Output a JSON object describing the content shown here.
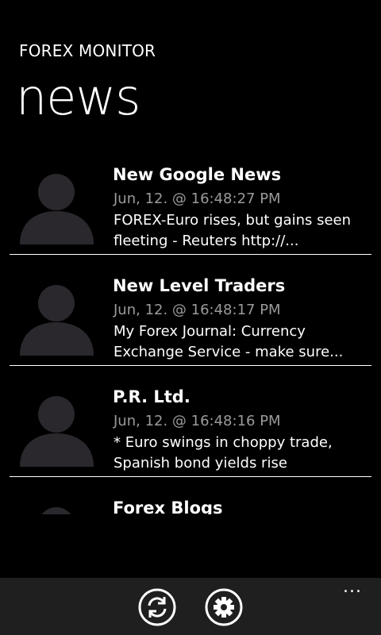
{
  "app": {
    "title": "FOREX MONITOR",
    "page_title": "news"
  },
  "news": [
    {
      "source": "New Google News",
      "time": "Jun, 12. @ 16:48:27 PM",
      "summary_line1": "FOREX-Euro rises, but gains seen",
      "summary_line2": "fleeting - Reuters http://..."
    },
    {
      "source": "New Level Traders",
      "time": "Jun, 12. @ 16:48:17 PM",
      "summary_line1": "My Forex Journal: Currency",
      "summary_line2": "Exchange Service - make sure..."
    },
    {
      "source": "P.R. Ltd.",
      "time": "Jun, 12. @ 16:48:16 PM",
      "summary_line1": "* Euro swings in choppy trade,",
      "summary_line2": "Spanish bond yields rise"
    },
    {
      "source": "Forex Blogs",
      "time": "",
      "summary_line1": "",
      "summary_line2": ""
    }
  ],
  "app_bar": {
    "more_label": "...",
    "buttons": [
      {
        "icon": "refresh-icon"
      },
      {
        "icon": "settings-icon"
      }
    ]
  },
  "colors": {
    "background": "#000000",
    "text": "#ffffff",
    "secondary_text": "#9a9a9a",
    "avatar": "#2a282d",
    "app_bar": "#1f1f1f"
  }
}
